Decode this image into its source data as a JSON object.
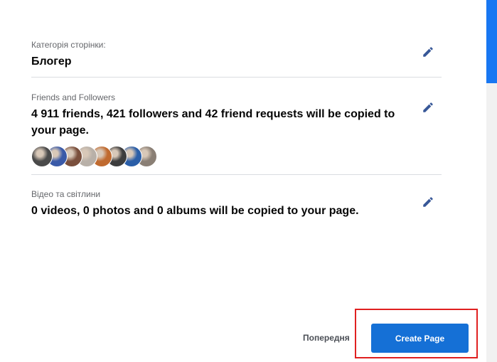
{
  "sections": [
    {
      "label": "Категорія сторінки:",
      "value": "Блогер"
    },
    {
      "label": "Friends and Followers",
      "value": "4 911 friends, 421 followers and 42 friend requests will be copied to your page."
    },
    {
      "label": "Відео та світлини",
      "value": "0 videos, 0 photos and 0 albums will be copied to your page."
    }
  ],
  "avatars": [
    {
      "color": "#4a4a4a"
    },
    {
      "color": "#3a5aa8"
    },
    {
      "color": "#7a4f3c"
    },
    {
      "color": "#b8b0a8"
    },
    {
      "color": "#c06a2f"
    },
    {
      "color": "#3d3d3d"
    },
    {
      "color": "#2a5ea8"
    },
    {
      "color": "#8a7f75"
    }
  ],
  "footer": {
    "back_label": "Попередня",
    "create_label": "Create Page"
  },
  "colors": {
    "accent": "#1570d6",
    "edit_icon": "#385898",
    "highlight": "#e02020"
  }
}
